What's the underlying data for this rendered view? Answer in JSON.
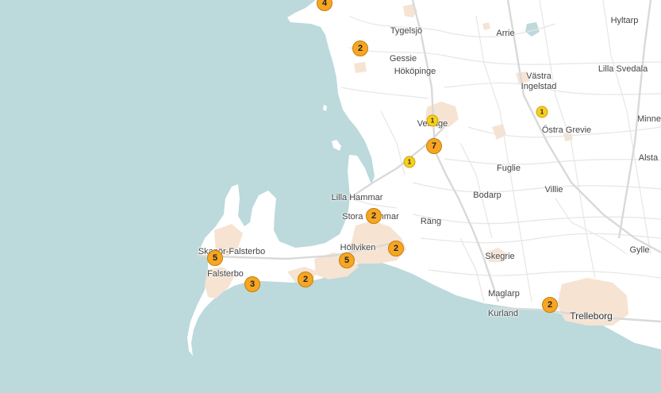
{
  "map": {
    "colors": {
      "water": "#bcd9dc",
      "land": "#ffffff",
      "urban": "#f6e3d2",
      "road": "#e4e4e4",
      "major_road": "#d6d6d6",
      "cluster_large": "#f6a623",
      "cluster_small": "#f6cf1c"
    },
    "places": [
      {
        "id": "tygelsjo",
        "label": "Tygelsjö"
      },
      {
        "id": "arrie",
        "label": "Arrie"
      },
      {
        "id": "hyltarp",
        "label": "Hyltarp"
      },
      {
        "id": "gessie",
        "label": "Gessie"
      },
      {
        "id": "hokopinge",
        "label": "Hököpinge"
      },
      {
        "id": "vastra-ingelstad",
        "label": "Västra\nIngelstad"
      },
      {
        "id": "lilla-svedala",
        "label": "Lilla Svedala"
      },
      {
        "id": "vellinge",
        "label": "Vellinge"
      },
      {
        "id": "ostra-grevie",
        "label": "Östra Grevie"
      },
      {
        "id": "minne",
        "label": "Minne"
      },
      {
        "id": "alsta",
        "label": "Alsta"
      },
      {
        "id": "fuglie",
        "label": "Fuglie"
      },
      {
        "id": "villie",
        "label": "Villie"
      },
      {
        "id": "bodarp",
        "label": "Bodarp"
      },
      {
        "id": "lilla-hammar",
        "label": "Lilla Hammar"
      },
      {
        "id": "stora-hammar",
        "label": "Stora Hammar"
      },
      {
        "id": "rang",
        "label": "Räng"
      },
      {
        "id": "hollviken",
        "label": "Höllviken"
      },
      {
        "id": "skegrie",
        "label": "Skegrie"
      },
      {
        "id": "gylle",
        "label": "Gylle"
      },
      {
        "id": "skanor-falsterbo",
        "label": "Skanör-Falsterbo"
      },
      {
        "id": "falsterbo",
        "label": "Falsterbo"
      },
      {
        "id": "maglarp",
        "label": "Maglarp"
      },
      {
        "id": "kurland",
        "label": "Kurland"
      },
      {
        "id": "trelleborg",
        "label": "Trelleborg"
      }
    ],
    "clusters": [
      {
        "id": "c1",
        "count": "4"
      },
      {
        "id": "c2",
        "count": "2"
      },
      {
        "id": "c3",
        "count": "1"
      },
      {
        "id": "c4",
        "count": "1"
      },
      {
        "id": "c5",
        "count": "7"
      },
      {
        "id": "c6",
        "count": "1"
      },
      {
        "id": "c7",
        "count": "2"
      },
      {
        "id": "c8",
        "count": "2"
      },
      {
        "id": "c9",
        "count": "5"
      },
      {
        "id": "c10",
        "count": "5"
      },
      {
        "id": "c11",
        "count": "3"
      },
      {
        "id": "c12",
        "count": "2"
      },
      {
        "id": "c13",
        "count": "2"
      }
    ]
  }
}
